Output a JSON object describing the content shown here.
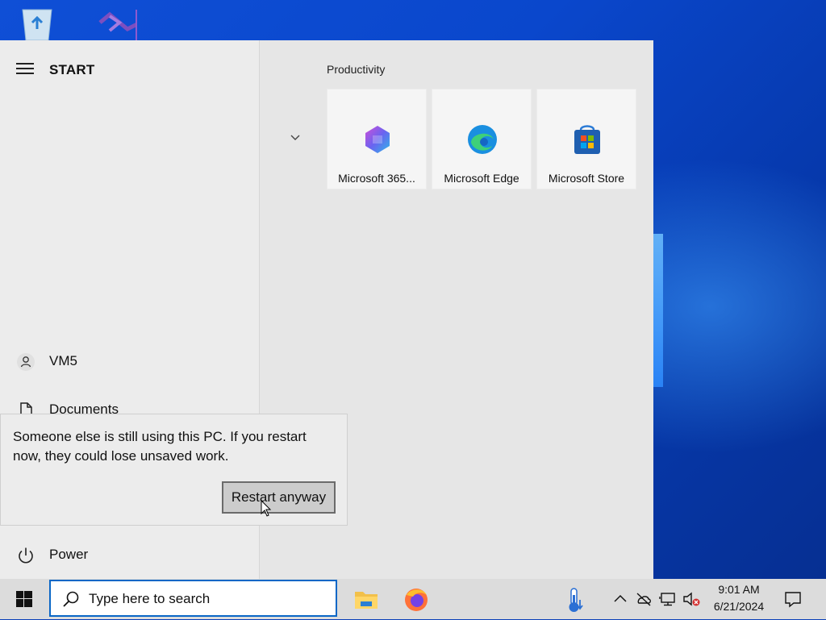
{
  "desktop": {
    "icons": [
      {
        "name": "recycle-bin"
      },
      {
        "name": "visual-studio"
      }
    ]
  },
  "start_menu": {
    "header": "START",
    "left_nav": {
      "user": {
        "label": "VM5",
        "icon": "user-icon"
      },
      "documents": {
        "label": "Documents",
        "icon": "document-icon"
      },
      "power": {
        "label": "Power",
        "icon": "power-icon"
      }
    },
    "group": {
      "title": "Productivity",
      "tiles": [
        {
          "label": "Microsoft 365...",
          "icon": "microsoft-365-icon"
        },
        {
          "label": "Microsoft Edge",
          "icon": "edge-icon"
        },
        {
          "label": "Microsoft Store",
          "icon": "store-icon"
        }
      ]
    }
  },
  "flyout": {
    "message": "Someone else is still using this PC. If you restart now, they could lose unsaved work.",
    "button_label": "Restart anyway"
  },
  "taskbar": {
    "search_placeholder": "Type here to search",
    "pinned_apps": [
      "file-explorer",
      "firefox",
      "temperature-app"
    ],
    "clock": {
      "time": "9:01 AM",
      "date": "6/21/2024"
    }
  },
  "colors": {
    "accent": "#0a67c6",
    "desktop_bg": "#0a47cc"
  }
}
